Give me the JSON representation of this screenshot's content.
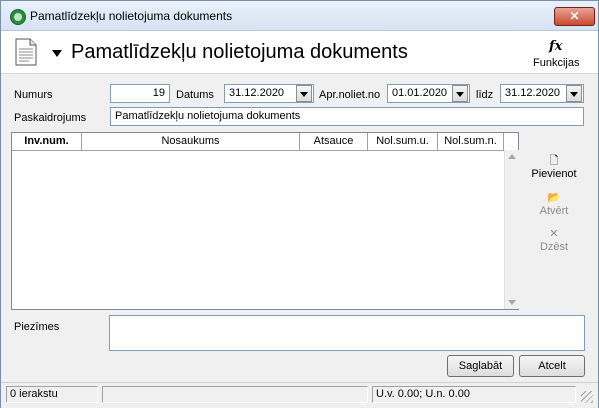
{
  "window": {
    "title": "Pamatlīdzekļu nolietojuma dokuments",
    "close_glyph": "✕"
  },
  "header": {
    "title": "Pamatlīdzekļu nolietojuma dokuments",
    "functions_icon": "fx",
    "functions_label": "Funkcijas"
  },
  "form": {
    "numurs_label": "Numurs",
    "numurs_value": "19",
    "datums_label": "Datums",
    "datums_value": "31.12.2020",
    "apr_label": "Apr.noliet.no",
    "apr_value": "01.01.2020",
    "lidz_label": "līdz",
    "lidz_value": "31.12.2020",
    "paskaidrojums_label": "Paskaidrojums",
    "paskaidrojums_value": "Pamatlīdzekļu nolietojuma dokuments"
  },
  "table": {
    "columns": [
      "Inv.num.",
      "Nosaukums",
      "Atsauce",
      "Nol.sum.u.",
      "Nol.sum.n."
    ],
    "rows": []
  },
  "side_actions": {
    "add_label": "Pievienot",
    "add_icon": "🗋",
    "open_label": "Atvērt",
    "open_icon": "📂",
    "delete_label": "Dzēst",
    "delete_icon": "✕"
  },
  "notes": {
    "label": "Piezīmes",
    "value": ""
  },
  "buttons": {
    "save_label": "Saglabāt",
    "cancel_label": "Atcelt"
  },
  "status": {
    "records": "0 ierakstu",
    "middle": "",
    "totals": "U.v. 0.00; U.n. 0.00"
  }
}
